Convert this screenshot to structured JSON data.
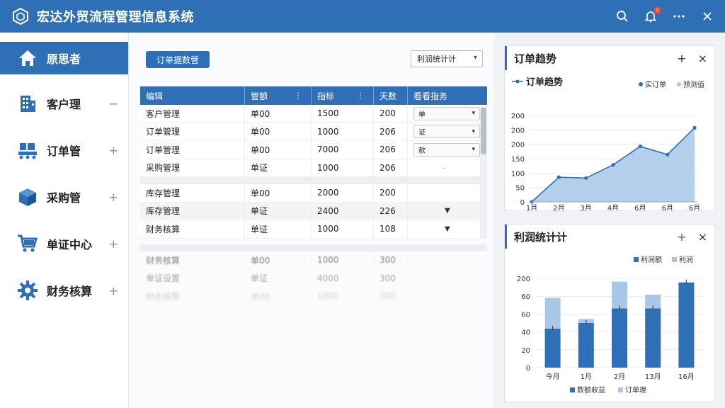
{
  "app": {
    "title": "宏达外贸流程管理信息系统"
  },
  "titlebar": {
    "notification_count": "2"
  },
  "sidebar": {
    "items": [
      {
        "label": "原思者",
        "toggle": ""
      },
      {
        "label": "客户理",
        "toggle": "−"
      },
      {
        "label": "订单管",
        "toggle": "+"
      },
      {
        "label": "采购管",
        "toggle": "+"
      },
      {
        "label": "单证中心",
        "toggle": "+"
      },
      {
        "label": "财务核算",
        "toggle": "+"
      }
    ]
  },
  "main": {
    "primary_button": "订单据数营",
    "top_select": "利润统计计",
    "columns": [
      "编辑",
      "管额",
      "指标",
      "天数",
      "看看指务"
    ],
    "rows": [
      {
        "c1": "客户管理",
        "c2": "单00",
        "c3": "1500",
        "c4": "200",
        "c5": "单"
      },
      {
        "c1": "订单管理",
        "c2": "单00",
        "c3": "1000",
        "c4": "206",
        "c5": "证"
      },
      {
        "c1": "订单管理",
        "c2": "单00",
        "c3": "7000",
        "c4": "206",
        "c5": "款"
      },
      {
        "c1": "采购管理",
        "c2": "单证",
        "c3": "1000",
        "c4": "206",
        "c5": ""
      },
      {
        "c1": "库存管理",
        "c2": "单00",
        "c3": "2000",
        "c4": "200",
        "c5": ""
      },
      {
        "c1": "库存管理",
        "c2": "单证",
        "c3": "2400",
        "c4": "226",
        "c5": ""
      },
      {
        "c1": "财务核算",
        "c2": "单证",
        "c3": "1000",
        "c4": "108",
        "c5": ""
      }
    ],
    "faded_rows": [
      {
        "c1": "财务核算",
        "c2": "单00",
        "c3": "1000",
        "c4": "300"
      },
      {
        "c1": "单证设置",
        "c2": "单证",
        "c3": "4000",
        "c4": "300"
      },
      {
        "c1": "财务核算",
        "c2": "单00",
        "c3": "1000",
        "c4": "300"
      }
    ]
  },
  "panel_trend": {
    "title": "订单趋势",
    "legend_series": "订单趋势",
    "legend_a": "实订单",
    "legend_b": "预测值",
    "add": "+",
    "close": "×"
  },
  "panel_profit": {
    "title": "利润统计计",
    "legend_top_a": "利润额",
    "legend_top_b": "利润",
    "legend_bottom_a": "数额收益",
    "legend_bottom_b": "订单理",
    "add": "+",
    "close": "×"
  },
  "colors": {
    "primary": "#2f6fb5",
    "light": "#a9c8e8",
    "area": "#a7c7e7"
  },
  "chart_data": [
    {
      "type": "area",
      "title": "订单趋势",
      "categories": [
        "1月",
        "2月",
        "3月",
        "4月",
        "6月",
        "6月",
        "6月"
      ],
      "y_ticks": [
        "0",
        "50",
        "100",
        "150",
        "200",
        "200",
        "200"
      ],
      "values": [
        0,
        60,
        58,
        90,
        135,
        115,
        180
      ],
      "ylim": [
        0,
        210
      ],
      "legend": "top-right"
    },
    {
      "type": "bar",
      "title": "利润统计计",
      "categories": [
        "今月",
        "1月",
        "2月",
        "13月",
        "16月"
      ],
      "y_ticks": [
        "0",
        "20",
        "40",
        "60",
        "60",
        "200"
      ],
      "series": [
        {
          "name": "利润额",
          "values": [
            48,
            55,
            73,
            73,
            105
          ]
        },
        {
          "name": "利润",
          "values": [
            38,
            5,
            33,
            17,
            0
          ]
        }
      ],
      "ylim": [
        0,
        110
      ],
      "legend": "top-right"
    }
  ]
}
